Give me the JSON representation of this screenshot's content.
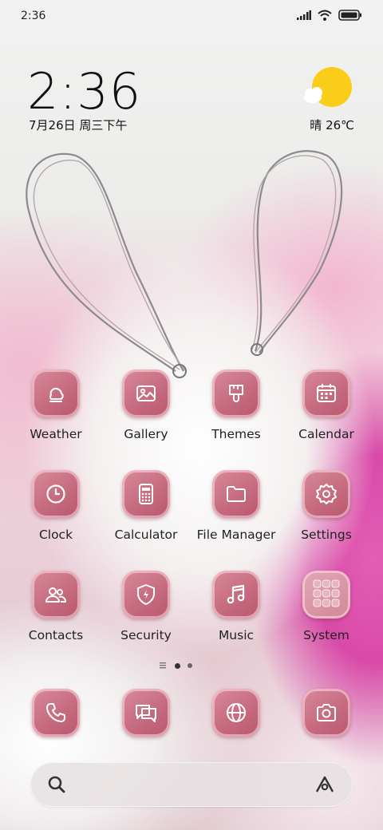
{
  "status_bar": {
    "time": "2:36",
    "icons": [
      "signal-icon",
      "wifi-icon",
      "battery-icon"
    ]
  },
  "clock_widget": {
    "time": "2:36",
    "date": "7月26日 周三下午"
  },
  "weather_widget": {
    "icon": "sun-cloud-icon",
    "text": "晴 26℃"
  },
  "apps": [
    {
      "label": "Weather",
      "icon": "weather-icon"
    },
    {
      "label": "Gallery",
      "icon": "gallery-icon"
    },
    {
      "label": "Themes",
      "icon": "themes-icon"
    },
    {
      "label": "Calendar",
      "icon": "calendar-icon"
    },
    {
      "label": "Clock",
      "icon": "clock-icon"
    },
    {
      "label": "Calculator",
      "icon": "calculator-icon"
    },
    {
      "label": "File Manager",
      "icon": "folder-icon"
    },
    {
      "label": "Settings",
      "icon": "gear-icon"
    },
    {
      "label": "Contacts",
      "icon": "contacts-icon"
    },
    {
      "label": "Security",
      "icon": "shield-icon"
    },
    {
      "label": "Music",
      "icon": "music-icon"
    },
    {
      "label": "System",
      "icon": "folder-grid-icon"
    }
  ],
  "page_indicator": {
    "pages": 2,
    "current": 1
  },
  "dock": [
    {
      "icon": "phone-icon"
    },
    {
      "icon": "messages-icon"
    },
    {
      "icon": "browser-icon"
    },
    {
      "icon": "camera-icon"
    }
  ],
  "search_bar": {
    "left_icon": "search-icon",
    "right_icon": "assistant-icon"
  },
  "colors": {
    "icon_bg": "#c66b80",
    "text": "#222222",
    "sun": "#f9cd18"
  }
}
